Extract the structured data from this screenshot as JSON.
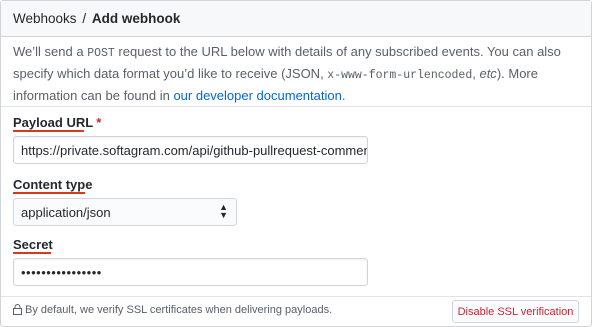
{
  "breadcrumb": {
    "parent": "Webhooks",
    "separator": "/",
    "current": "Add webhook"
  },
  "intro": {
    "p1": "We’ll send a ",
    "code_post": "POST",
    "p2": " request to the URL below with details of any subscribed events. You can also specify which data format you’d like to receive (JSON, ",
    "code_form": "x-www-form-urlencoded",
    "p3": ", ",
    "etc": "etc",
    "p4": "). More information can be found in ",
    "link": "our developer documentation",
    "p5": "."
  },
  "payload_url": {
    "label": "Payload URL",
    "required_mark": "*",
    "value": "https://private.softagram.com/api/github-pullrequest-commented"
  },
  "content_type": {
    "label": "Content type",
    "value": "application/json",
    "options": [
      "application/json"
    ]
  },
  "secret": {
    "label": "Secret",
    "value": "••••••••••••••••"
  },
  "footer": {
    "note": "By default, we verify SSL certificates when delivering payloads.",
    "button": "Disable SSL verification"
  },
  "colors": {
    "accent_underline": "#d73a1a",
    "link": "#0366d6",
    "danger": "#cb2431"
  }
}
